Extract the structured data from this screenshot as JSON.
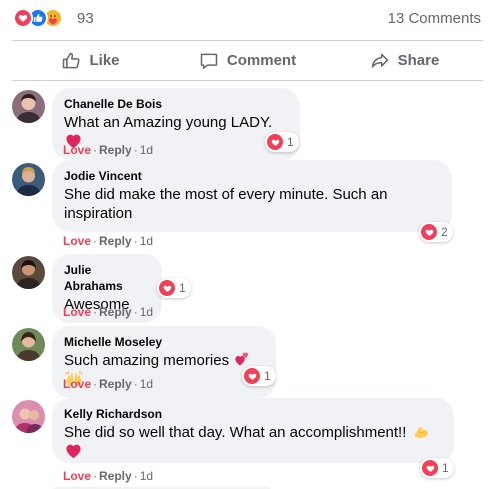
{
  "summary": {
    "reactions": [
      "love",
      "like",
      "care"
    ],
    "reaction_count": "93",
    "comments_label": "13 Comments"
  },
  "actions": [
    {
      "label": "Like",
      "icon": "thumbs-up-icon"
    },
    {
      "label": "Comment",
      "icon": "comment-icon"
    },
    {
      "label": "Share",
      "icon": "share-icon"
    }
  ],
  "colors": {
    "love": "#f33e58",
    "like": "#1877f2",
    "muted": "#65676b",
    "bubble": "#f0f2f5"
  },
  "comments": [
    {
      "author": "Chanelle De Bois",
      "text": "What an Amazing young LADY.",
      "emoji": "red-heart",
      "reaction_count": "1",
      "love": "Love",
      "reply": "Reply",
      "time": "1d"
    },
    {
      "author": "Jodie Vincent",
      "text": "She did make the most of every minute. Such an inspiration",
      "reaction_count": "2",
      "love": "Love",
      "reply": "Reply",
      "time": "1d"
    },
    {
      "author": "Julie Abrahams",
      "text": "Awesome",
      "reaction_count": "1",
      "love": "Love",
      "reply": "Reply",
      "time": "1d"
    },
    {
      "author": "Michelle Moseley",
      "text": "Such amazing memories",
      "emoji": "hearts-and-raised-hands",
      "reaction_count": "1",
      "love": "Love",
      "reply": "Reply",
      "time": "1d"
    },
    {
      "author": "Kelly Richardson",
      "text": "She did so well that day. What an accomplishment!!",
      "emoji": "flexed-biceps-and-red-heart",
      "reaction_count": "1",
      "love": "Love",
      "reply": "Reply",
      "time": "1d"
    }
  ],
  "separator": "·"
}
